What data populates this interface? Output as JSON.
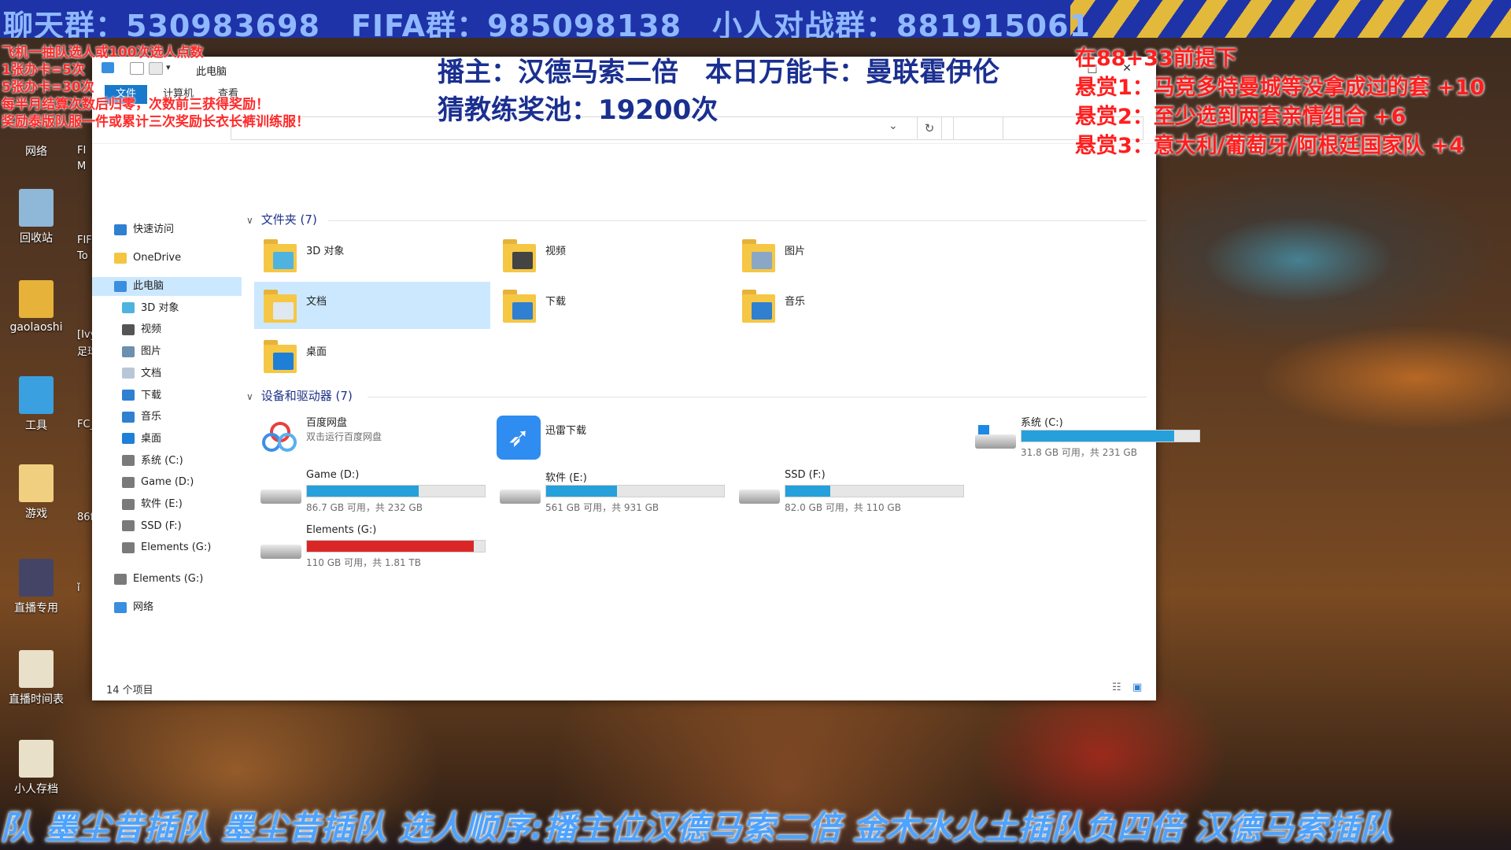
{
  "top_banner": {
    "text": "聊天群：530983698　FIFA群：985098138　小人对战群：881915061"
  },
  "overlay_left": {
    "lines": [
      "飞机一抽队选人或100次选人点数",
      "1张办卡=5次",
      "5张办卡=30次",
      "每半月结算次数后归零，次数前三获得奖励！",
      "奖励泰版队服一件或累计三次奖励长衣长裤训练服！"
    ]
  },
  "overlay_host": {
    "line1": "播主：汉德马索二倍　本日万能卡：曼联霍伊伦",
    "line2": "猜教练奖池：19200次"
  },
  "overlay_right": {
    "lines": [
      "在88+33前提下",
      "悬赏1：马竞多特曼城等没拿成过的套 +10",
      "悬赏2：至少选到两套亲情组合 +6",
      "悬赏3：意大利/葡萄牙/阿根廷国家队 +4"
    ]
  },
  "desktop_icons": [
    {
      "label": "网络",
      "icon": "network-icon"
    },
    {
      "label": "回收站",
      "icon": "recycle-bin-icon"
    },
    {
      "label": "gaolaoshi",
      "icon": "user-folder-icon"
    },
    {
      "label": "工具",
      "icon": "tools-icon"
    },
    {
      "label": "游戏",
      "icon": "folder-icon"
    },
    {
      "label": "直播专用",
      "icon": "app-icon"
    },
    {
      "label": "直播时间表",
      "icon": "document-icon"
    },
    {
      "label": "小人存档",
      "icon": "document-icon"
    }
  ],
  "desktop_icons_col2": [
    "FI",
    "M",
    "FIF",
    "To",
    "[Ivy",
    "足球",
    "FC_",
    "86f",
    "ǐ"
  ],
  "window": {
    "title": "此电脑",
    "tabs": [
      "文件",
      "计算机",
      "查看"
    ],
    "status": "14 个项目"
  },
  "nav": {
    "items": [
      {
        "label": "快速访问",
        "icon": "star-icon",
        "indent": 0,
        "color": "#2f80d0"
      },
      {
        "label": "OneDrive",
        "icon": "onedrive-icon",
        "indent": 0,
        "color": "#f3c542"
      },
      {
        "label": "此电脑",
        "icon": "computer-icon",
        "indent": 0,
        "color": "#3a8ee0",
        "selected": true
      },
      {
        "label": "3D 对象",
        "icon": "cube-icon",
        "indent": 1,
        "color": "#4fb3e0"
      },
      {
        "label": "视频",
        "icon": "video-icon",
        "indent": 1,
        "color": "#555555"
      },
      {
        "label": "图片",
        "icon": "picture-icon",
        "indent": 1,
        "color": "#6d8fb0"
      },
      {
        "label": "文档",
        "icon": "document-icon",
        "indent": 1,
        "color": "#b9c6d8"
      },
      {
        "label": "下载",
        "icon": "download-icon",
        "indent": 1,
        "color": "#2f80d0"
      },
      {
        "label": "音乐",
        "icon": "music-icon",
        "indent": 1,
        "color": "#2f80d0"
      },
      {
        "label": "桌面",
        "icon": "desktop-icon",
        "indent": 1,
        "color": "#1e7fd6"
      },
      {
        "label": "系统 (C:)",
        "icon": "drive-icon",
        "indent": 1,
        "color": "#7a7a7a"
      },
      {
        "label": "Game (D:)",
        "icon": "drive-icon",
        "indent": 1,
        "color": "#7a7a7a"
      },
      {
        "label": "软件 (E:)",
        "icon": "drive-icon",
        "indent": 1,
        "color": "#7a7a7a"
      },
      {
        "label": "SSD (F:)",
        "icon": "drive-icon",
        "indent": 1,
        "color": "#7a7a7a"
      },
      {
        "label": "Elements (G:)",
        "icon": "drive-icon",
        "indent": 1,
        "color": "#7a7a7a"
      },
      {
        "label": "Elements (G:)",
        "icon": "drive-icon",
        "indent": 0,
        "color": "#7a7a7a"
      },
      {
        "label": "网络",
        "icon": "network-icon",
        "indent": 0,
        "color": "#3a8ee0"
      }
    ]
  },
  "content": {
    "folders_header": "文件夹 (7)",
    "folders": [
      {
        "label": "3D 对象",
        "icon": "cube-folder-icon",
        "accent": "#4fb3e0"
      },
      {
        "label": "视频",
        "icon": "video-folder-icon",
        "accent": "#444444"
      },
      {
        "label": "图片",
        "icon": "picture-folder-icon",
        "accent": "#8aa7c5"
      },
      {
        "label": "文档",
        "icon": "document-folder-icon",
        "accent": "#dfe7f0",
        "selected": true
      },
      {
        "label": "下载",
        "icon": "download-folder-icon",
        "accent": "#2f80d0"
      },
      {
        "label": "音乐",
        "icon": "music-folder-icon",
        "accent": "#2f80d0"
      },
      {
        "label": "桌面",
        "icon": "desktop-folder-icon",
        "accent": "#1e7fd6"
      }
    ],
    "devices_header": "设备和驱动器 (7)",
    "apps": [
      {
        "name": "百度网盘",
        "subtitle": "双击运行百度网盘",
        "icon": "baidu-netdisk-icon"
      },
      {
        "name": "迅雷下载",
        "icon": "xunlei-icon"
      }
    ],
    "drives": [
      {
        "name": "系统 (C:)",
        "free": "31.8 GB 可用，共 231 GB",
        "used_fraction": 0.86,
        "full": false,
        "icon": "windows-drive-icon"
      },
      {
        "name": "Game (D:)",
        "free": "86.7 GB 可用，共 232 GB",
        "used_fraction": 0.63,
        "full": false,
        "icon": "drive-icon"
      },
      {
        "name": "软件 (E:)",
        "free": "561 GB 可用，共 931 GB",
        "used_fraction": 0.4,
        "full": false,
        "icon": "drive-icon"
      },
      {
        "name": "SSD (F:)",
        "free": "82.0 GB 可用，共 110 GB",
        "used_fraction": 0.25,
        "full": false,
        "icon": "drive-icon"
      },
      {
        "name": "Elements (G:)",
        "free": "110 GB 可用，共 1.81 TB",
        "used_fraction": 0.94,
        "full": true,
        "icon": "drive-icon"
      }
    ]
  },
  "bottom_ticker": {
    "text": "队 墨尘昔插队 墨尘昔插队 选人顺序:播主位汉德马索二倍 金木水火土插队负四倍 汉德马索插队"
  },
  "colors": {
    "accent": "#1979ca",
    "bar": "#26a0da",
    "bar_full": "#da2626",
    "banner": "#1f33a8"
  }
}
